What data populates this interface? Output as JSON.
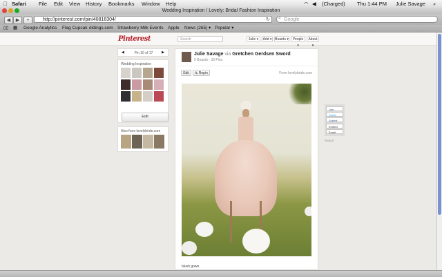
{
  "menubar": {
    "app": "Safari",
    "items": [
      "File",
      "Edit",
      "View",
      "History",
      "Bookmarks",
      "Window",
      "Help"
    ],
    "status": "(Charged)",
    "clock": "Thu 1:44 PM",
    "user": "Julie Savage"
  },
  "window": {
    "title": "Wedding Inspiration / Lovely: Bridal Fashion Inspiration"
  },
  "toolbar": {
    "url": "http://pinterest.com/pin/40816304/",
    "search_placeholder": "Google"
  },
  "bookmarks": [
    "Google Analytics",
    "Flag Cupcak",
    "didings.com",
    "Strawberry Milk Events",
    "Apple",
    "News (265) ▾",
    "Popular ▾"
  ],
  "pinterest": {
    "logo": "Pinterest",
    "search_placeholder": "Search",
    "nav": [
      "Julie ▾",
      "Add ▾",
      "Boards ▾",
      "People ▾",
      "About ▾"
    ],
    "pager": "Pin 10 of 17",
    "board_title": "Wedding Inspiration",
    "edit_label": "Edit",
    "also_from": "Also from lovelybride.com",
    "pinner_name": "Julie Savage",
    "via_word": "via",
    "via_name": "Gretchen Gerdsen Sword",
    "boards_pins": "5 Boards · 33 Pins",
    "edit_btn": "Edit",
    "repin_btn": "Repin",
    "source": "From lovelybride.com",
    "caption": "blush gown",
    "share": [
      "Like",
      "Tweet",
      "Submit",
      "Embed",
      "Email"
    ],
    "report": "Report"
  },
  "colors": {
    "brand": "#b5202a",
    "scroll_thumb": "#7a92cf"
  }
}
